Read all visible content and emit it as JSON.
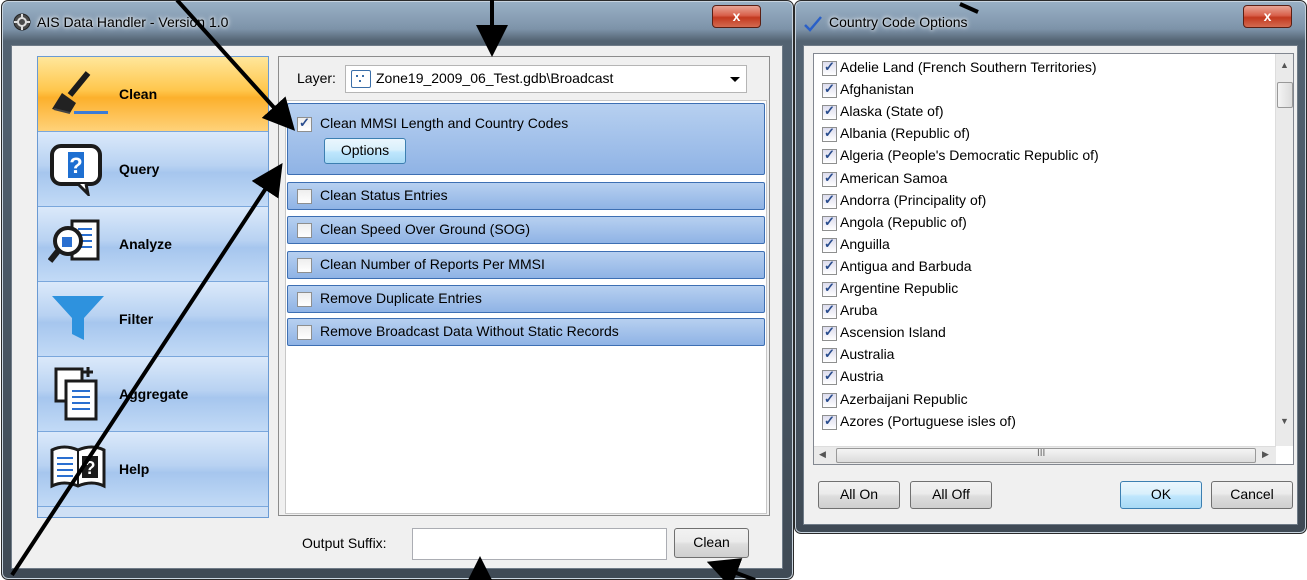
{
  "main_window": {
    "title": "AIS Data Handler - Version 1.0",
    "close_label": "x"
  },
  "nav": {
    "items": [
      {
        "label": "Clean",
        "icon": "broom-icon",
        "active": true
      },
      {
        "label": "Query",
        "icon": "question-bubble-icon",
        "active": false
      },
      {
        "label": "Analyze",
        "icon": "magnifier-document-icon",
        "active": false
      },
      {
        "label": "Filter",
        "icon": "funnel-icon",
        "active": false
      },
      {
        "label": "Aggregate",
        "icon": "stacked-documents-icon",
        "active": false
      },
      {
        "label": "Help",
        "icon": "book-question-icon",
        "active": false
      }
    ]
  },
  "layer": {
    "label": "Layer:",
    "value": "Zone19_2009_06_Test.gdb\\Broadcast",
    "icon": "point-layer-icon"
  },
  "tasks": [
    {
      "label": "Clean MMSI Length and Country Codes",
      "checked": true,
      "options_label": "Options"
    },
    {
      "label": "Clean Status Entries",
      "checked": false
    },
    {
      "label": "Clean Speed Over Ground (SOG)",
      "checked": false
    },
    {
      "label": "Clean Number of Reports Per MMSI",
      "checked": false
    },
    {
      "label": "Remove Duplicate Entries",
      "checked": false
    },
    {
      "label": "Remove Broadcast Data Without Static Records",
      "checked": false
    }
  ],
  "output": {
    "label": "Output Suffix:",
    "value": "",
    "clean_button": "Clean"
  },
  "country_window": {
    "title": "Country Code Options",
    "close_label": "x",
    "countries": [
      "Adelie Land (French Southern Territories)",
      "Afghanistan",
      "Alaska (State of)",
      "Albania (Republic of)",
      "Algeria (People's Democratic Republic of)",
      "American Samoa",
      "Andorra (Principality of)",
      "Angola (Republic of)",
      "Anguilla",
      "Antigua and Barbuda",
      "Argentine Republic",
      "Aruba",
      "Ascension Island",
      "Australia",
      "Austria",
      "Azerbaijani Republic",
      "Azores (Portuguese isles of)"
    ],
    "scroll_mark": "III",
    "all_on": "All On",
    "all_off": "All Off",
    "ok": "OK",
    "cancel": "Cancel"
  },
  "colors": {
    "active_nav": "#fcb02c",
    "task_bar": "#8fb3e5",
    "close_button": "#c2391f"
  }
}
